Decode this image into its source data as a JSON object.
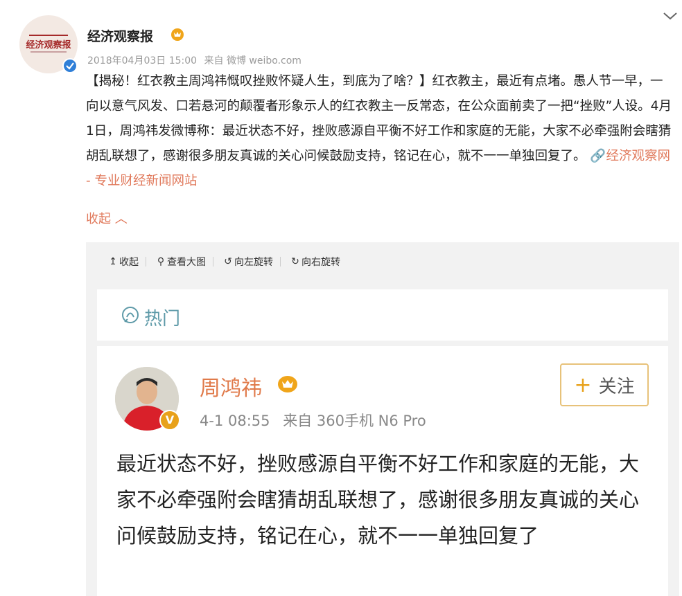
{
  "account": {
    "name": "经济观察报",
    "avatar_text": "经济观察报",
    "timestamp": "2018年04月03日 15:00",
    "source": "来自 微博 weibo.com"
  },
  "post": {
    "text": "【揭秘！红衣教主周鸿祎慨叹挫败怀疑人生，到底为了啥？】红衣教主，最近有点堵。愚人节一早，一向以意气风发、口若悬河的颠覆者形象示人的红衣教主一反常态，在公众面前卖了一把“挫败”人设。4月1日，周鸿祎发微博称：最近状态不好，挫败感源自平衡不好工作和家庭的无能，大家不必牵强附会瞎猜胡乱联想了，感谢很多朋友真诚的关心问候鼓励支持，铭记在心，就不一一单独回复了。",
    "link_text": "经济观察网 - 专业财经新闻网站",
    "collapse": "收起"
  },
  "toolbar": {
    "collapse": "收起",
    "view_large": "查看大图",
    "rotate_left": "向左旋转",
    "rotate_right": "向右旋转"
  },
  "hot": {
    "label": "热门"
  },
  "embedded": {
    "name": "周鸿祎",
    "time": "4-1 08:55",
    "source": "来自 360手机 N6 Pro",
    "follow": "关注",
    "text": "最近状态不好，挫败感源自平衡不好工作和家庭的无能，大家不必牵强附会瞎猜胡乱联想了，感谢很多朋友真诚的关心问候鼓励支持，铭记在心，就不一一单独回复了"
  },
  "icons": {
    "expand": "chevron-down-icon",
    "vip": "vip-crown-icon",
    "verified": "verified-icon",
    "link": "link-icon",
    "collapse": "arrow-up-icon",
    "zoom": "magnifier-icon",
    "rotate_left": "rotate-left-icon",
    "rotate_right": "rotate-right-icon",
    "hot": "hot-topic-icon",
    "plus": "plus-icon"
  },
  "colors": {
    "link": "#e0785a",
    "name_orange": "#e07a4a",
    "verified_blue": "#2f7fd8",
    "verified_gold": "#e8a11a",
    "hot_teal": "#5e9aa8",
    "follow_border": "#e7c27a",
    "panel_bg": "#f2f2f2"
  }
}
